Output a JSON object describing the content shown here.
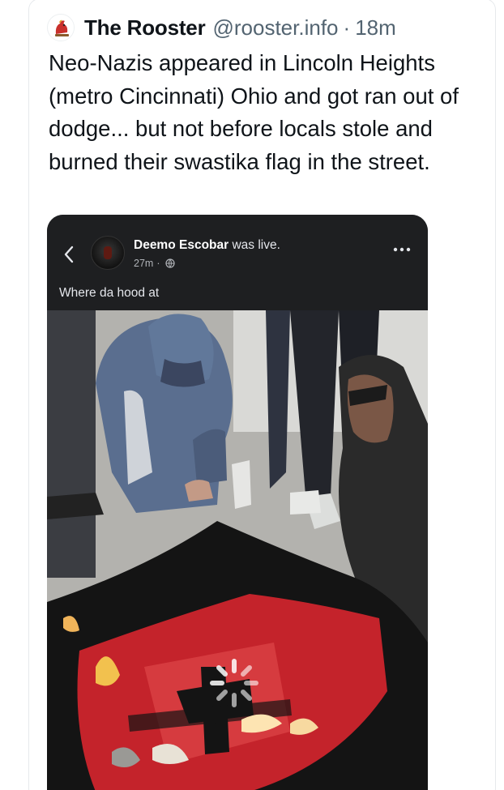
{
  "tweet": {
    "display_name": "The Rooster",
    "handle": "@rooster.info",
    "separator": "·",
    "time": "18m",
    "avatar_icon": "rooster-logo-icon",
    "text": "Neo-Nazis appeared in Lincoln Heights (metro Cincinnati) Ohio and got ran out of dodge... but not before locals stole and burned their swastika flag in the street."
  },
  "media": {
    "facebook_post": {
      "name": "Deemo Escobar",
      "status": "was live.",
      "time": "27m",
      "meta_separator": "·",
      "privacy_icon": "globe-icon",
      "caption": "Where da hood at",
      "back_icon": "chevron-left-icon",
      "menu_icon": "more-dots-icon"
    },
    "video": {
      "loading_icon": "loading-spinner-icon",
      "description": ""
    }
  },
  "colors": {
    "text_primary": "#0f1419",
    "text_secondary": "#536471",
    "facebook_bar": "#1e1f21",
    "flag_red": "#c4232b",
    "flag_black": "#141414"
  }
}
